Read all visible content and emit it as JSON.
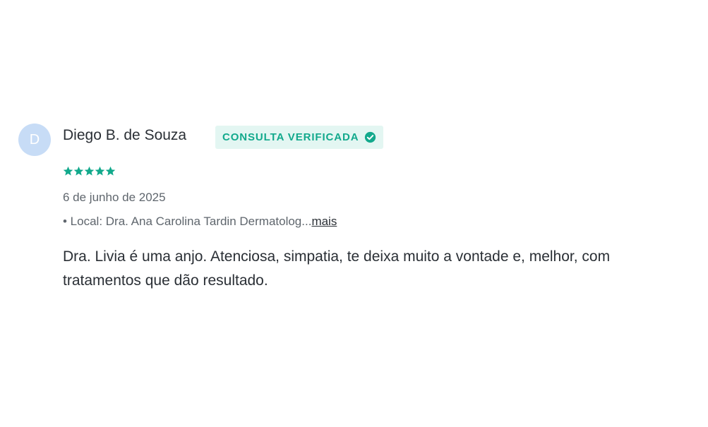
{
  "review": {
    "avatar_initial": "D",
    "author": "Diego B. de Souza",
    "badge": "CONSULTA VERIFICADA",
    "rating": 5,
    "date": "6 de junho de 2025",
    "location_prefix": "• Local: Dra. Ana Carolina Tardin Dermatolog...",
    "more_link": "mais",
    "text": "Dra. Livia é uma anjo. Atenciosa, simpatia, te deixa muito a vontade e, melhor, com tratamentos que dão resultado."
  },
  "colors": {
    "accent": "#12a98c",
    "badge_bg": "#e3f6f2",
    "avatar_bg": "#c7dcf6",
    "text": "#2a2f35",
    "muted": "#5f666d"
  },
  "icons": {
    "verified": "check-circle-icon",
    "star": "star-icon"
  }
}
